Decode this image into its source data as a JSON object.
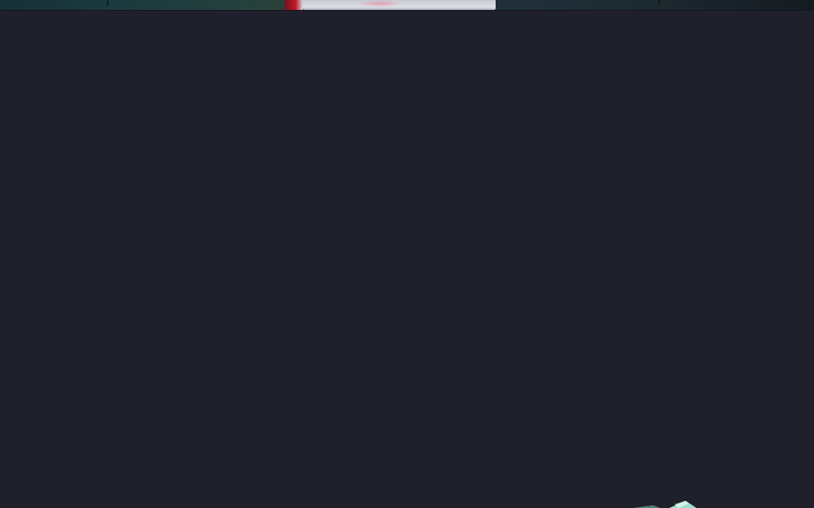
{
  "window": {
    "background_color": "#1f202b"
  },
  "top_strip": {
    "accent_red": "#c01a2c",
    "panel_light": "#dfe0e6",
    "panel_dark": "#163036"
  },
  "corner_shape": {
    "icon": "teal-diamond-icon",
    "color": "#9fe3cf"
  }
}
